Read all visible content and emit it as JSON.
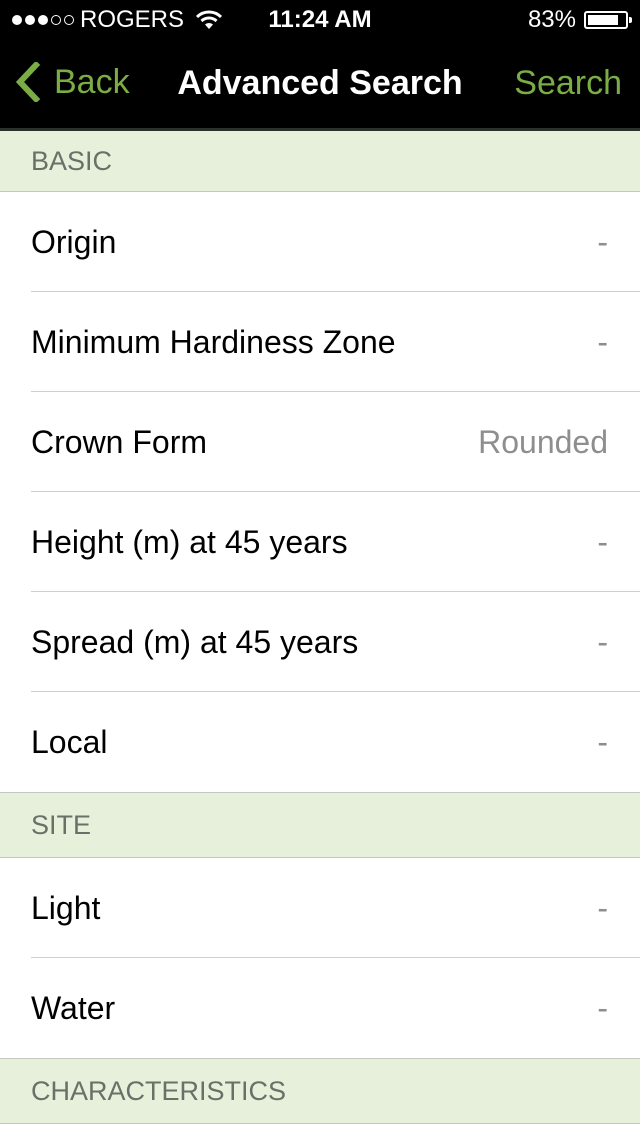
{
  "status_bar": {
    "signal_bars_filled": 3,
    "signal_bars_total": 5,
    "carrier": "ROGERS",
    "wifi_icon": "wifi-icon",
    "time": "11:24 AM",
    "battery_percent_label": "83%",
    "battery_level": 0.83
  },
  "nav": {
    "back_label": "Back",
    "title": "Advanced Search",
    "search_label": "Search",
    "accent_color": "#7aad44"
  },
  "sections": [
    {
      "header": "BASIC",
      "rows": [
        {
          "label": "Origin",
          "value": "-"
        },
        {
          "label": "Minimum Hardiness Zone",
          "value": "-"
        },
        {
          "label": "Crown Form",
          "value": "Rounded"
        },
        {
          "label": "Height (m) at 45 years",
          "value": "-"
        },
        {
          "label": "Spread (m) at 45 years",
          "value": "-"
        },
        {
          "label": "Local",
          "value": "-"
        }
      ]
    },
    {
      "header": "SITE",
      "rows": [
        {
          "label": "Light",
          "value": "-"
        },
        {
          "label": "Water",
          "value": "-"
        }
      ]
    },
    {
      "header": "CHARACTERISTICS",
      "rows": []
    }
  ]
}
